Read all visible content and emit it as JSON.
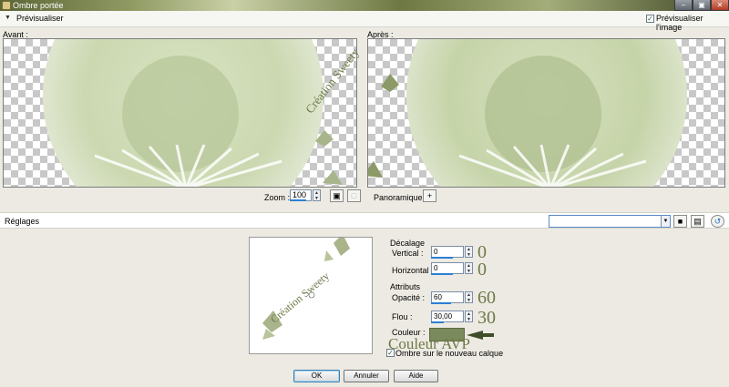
{
  "window": {
    "title": "Ombre portée",
    "min": "–",
    "max": "▣",
    "close": "✕"
  },
  "preview_row": {
    "collapse": "▼",
    "label": "Prévisualiser",
    "check_label": "Prévisualiser l'image",
    "checked": true
  },
  "panes": {
    "before_label": "Avant :",
    "after_label": "Après :"
  },
  "zoom": {
    "label": "Zoom :",
    "value": "100"
  },
  "pan": {
    "label": "Panoramique :"
  },
  "settings": {
    "label": "Réglages",
    "preset_value": ""
  },
  "thumbnail": {
    "watermark": "Création Sweety"
  },
  "offset": {
    "group": "Décalage",
    "vertical_label": "Vertical :",
    "vertical_value": "0",
    "vertical_note": "0",
    "horizontal_label": "Horizontal :",
    "horizontal_value": "0",
    "horizontal_note": "0"
  },
  "attributes": {
    "group": "Attributs",
    "opacity_label": "Opacité :",
    "opacity_value": "60",
    "opacity_note": "60",
    "opacity_fill": 0.6,
    "blur_label": "Flou :",
    "blur_value": "30,00",
    "blur_note": "30",
    "color_label": "Couleur :",
    "color_note": "Couleur AVP",
    "color_value": "#7a8a5c"
  },
  "new_layer": {
    "label": "Ombre sur le nouveau calque",
    "checked": true
  },
  "buttons": {
    "ok": "OK",
    "cancel": "Annuler",
    "help": "Aide"
  },
  "watermark_text": "Création Sweety",
  "icons": [
    "app-icon",
    "collapse-arrow-icon",
    "spin-arrows-icon",
    "fit-window-icon",
    "actual-size-icon",
    "pan-plus-icon",
    "save-preset-icon",
    "delete-preset-icon",
    "reset-icon",
    "pick-arrow-icon"
  ]
}
